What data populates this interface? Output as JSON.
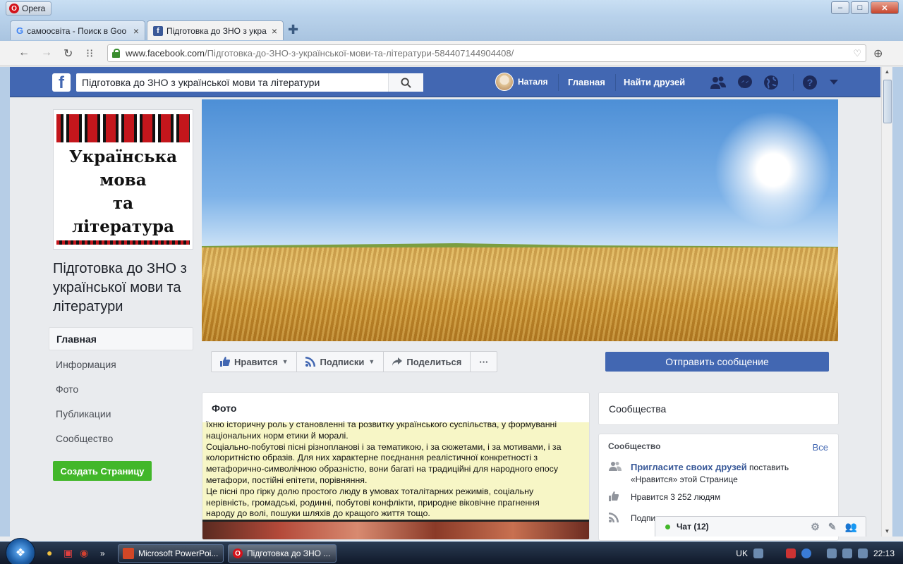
{
  "window": {
    "app_label": "Opera",
    "tabs": [
      {
        "label": "самоосвіта - Поиск в Goo",
        "icon": "google-g-icon"
      },
      {
        "label": "Підготовка до ЗНО з укра",
        "icon": "facebook-icon"
      }
    ]
  },
  "addressbar": {
    "host": "www.facebook.com",
    "path": "/Підготовка-до-ЗНО-з-української-мови-та-літератури-584407144904408/"
  },
  "fb_header": {
    "search_value": "Підготовка до ЗНО з української мови та літератури",
    "user_name": "Наталя",
    "home_link": "Главная",
    "find_friends_link": "Найти друзей"
  },
  "page": {
    "picture_text": [
      "Українська",
      "мова",
      "та",
      "література"
    ],
    "name": "Підготовка до ЗНО з української мови та літератури",
    "nav": [
      "Главная",
      "Информация",
      "Фото",
      "Публикации",
      "Сообщество"
    ],
    "create_page_button": "Создать Страницу"
  },
  "actions": {
    "like": "Нравится",
    "follow": "Подписки",
    "share": "Поделиться",
    "more": "···",
    "send_message": "Отправить сообщение"
  },
  "photo_card": {
    "title": "Фото",
    "text_lines": [
      "їхню історичну роль у становленні та розвитку українського суспільства, у формуванні",
      "національних норм етики й моралі.",
      "Соціально-побутові пісні різнопланові і за тематикою, і за сюжетами, і за мотивами, і за",
      "колоритністю образів. Для них характерне поєднання реалістичної конкретності з",
      "метафорично-символічною образністю, вони багаті на традиційні для народного епосу",
      "метафори, постійні епітети, порівняння.",
      "Це пісні про гірку долю простого люду в умовах тоталітарних режимів, соціальну",
      "нерівність, громадські, родинні, побутові конфлікти, природне віковічне прагнення",
      "народу до волі, пошуки шляхів до кращого життя тощо."
    ]
  },
  "community_header_card": {
    "title": "Сообщества"
  },
  "community_card": {
    "title": "Сообщество",
    "see_all": "Все",
    "invite_link": "Пригласите своих друзей",
    "invite_rest_1": " поставить",
    "invite_rest_2": "«Нравится» этой Странице",
    "likes_text": "Нравится 3 252 людям",
    "follow_text": "Подпи"
  },
  "chat": {
    "label": "Чат (12)"
  },
  "taskbar": {
    "items": [
      "Microsoft PowerPoi...",
      "Підготовка до ЗНО ..."
    ],
    "lang": "UK",
    "time": "22:13"
  },
  "colors": {
    "fb_blue": "#4267b2",
    "create_green": "#42b72a",
    "link_blue": "#385898"
  }
}
